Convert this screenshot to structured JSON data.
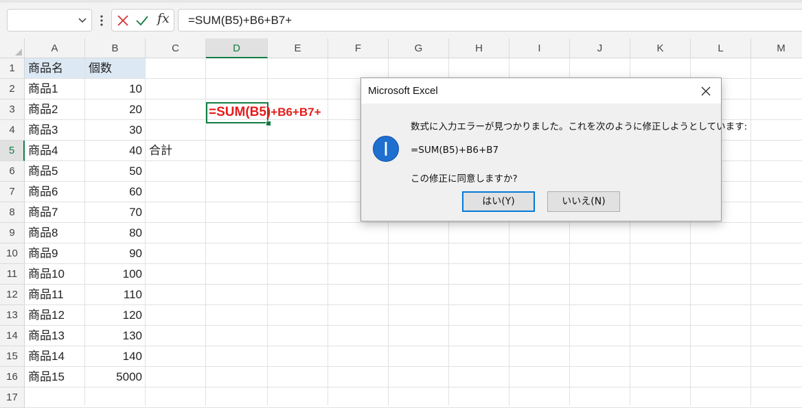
{
  "formula_bar": {
    "name_box_value": "",
    "formula": "=SUM(B5)+B6+B7+"
  },
  "columns": [
    "A",
    "B",
    "C",
    "D",
    "E",
    "F",
    "G",
    "H",
    "I",
    "J",
    "K",
    "L",
    "M"
  ],
  "rows": [
    "1",
    "2",
    "3",
    "4",
    "5",
    "6",
    "7",
    "8",
    "9",
    "10",
    "11",
    "12",
    "13",
    "14",
    "15",
    "16",
    "17"
  ],
  "active": {
    "column": "D",
    "row": "5"
  },
  "cells": {
    "A1": "商品名",
    "B1": "個数",
    "A2": "商品1",
    "B2": "10",
    "A3": "商品2",
    "B3": "20",
    "A4": "商品3",
    "B4": "30",
    "A5": "商品4",
    "B5": "40",
    "C5": "合計",
    "A6": "商品5",
    "B6": "50",
    "A7": "商品6",
    "B7": "60",
    "A8": "商品7",
    "B8": "70",
    "A9": "商品8",
    "B9": "80",
    "A10": "商品9",
    "B10": "90",
    "A11": "商品10",
    "B11": "100",
    "A12": "商品11",
    "B12": "110",
    "A13": "商品12",
    "B13": "120",
    "A14": "商品13",
    "B14": "130",
    "A15": "商品14",
    "B15": "140",
    "A16": "商品15",
    "B16": "5000"
  },
  "edit": {
    "part1": "=SUM(B5)",
    "part2": "+B6+B7+"
  },
  "colors": {
    "accent_green": "#107c41",
    "formula_red": "#e51c1c",
    "header_fill": "#dce9f5",
    "dialog_button_border": "#0078d7"
  },
  "dialog": {
    "title": "Microsoft Excel",
    "message": "数式に入力エラーが見つかりました。これを次のように修正しようとしています:",
    "suggestion": "=SUM(B5)+B6+B7",
    "question": "この修正に同意しますか?",
    "yes_label": "はい(Y)",
    "no_label": "いいえ(N)",
    "icon": "info-icon"
  }
}
